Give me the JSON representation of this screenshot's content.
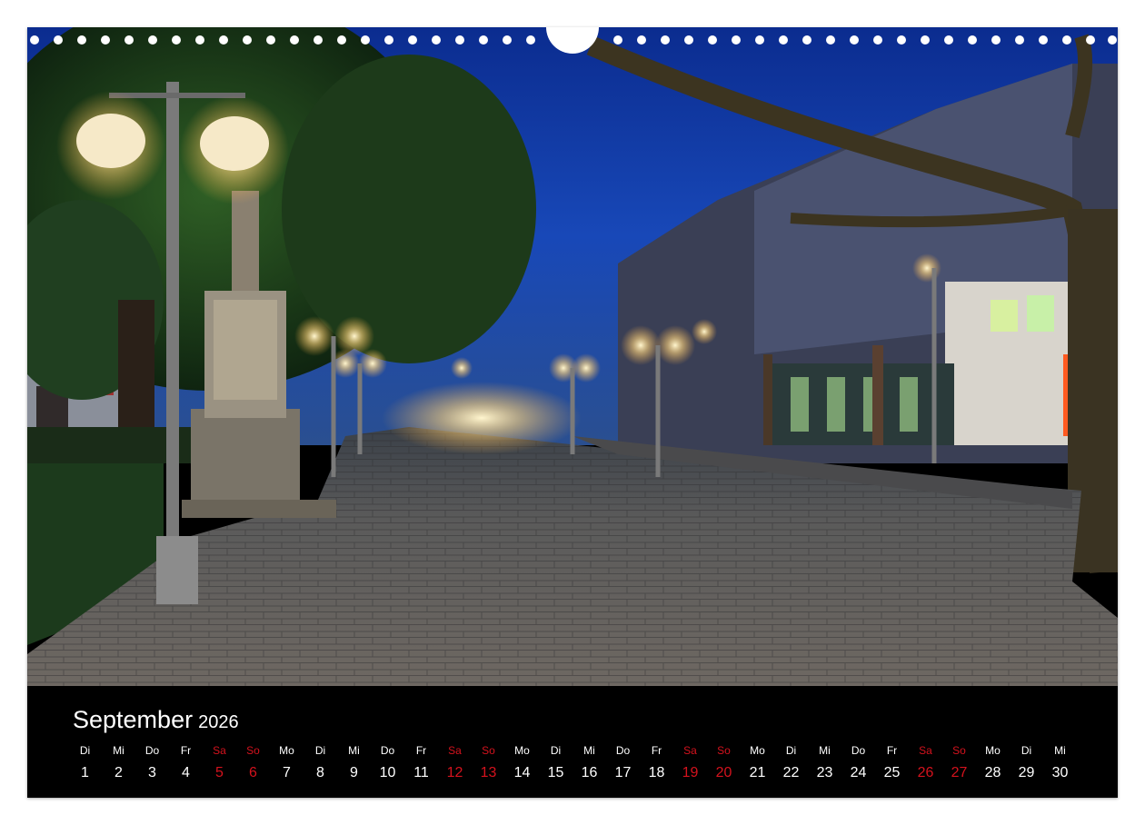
{
  "calendar": {
    "month": "September",
    "year": "2026",
    "weekend_color": "#d4121d",
    "text_color": "#ffffff",
    "days": [
      {
        "dow": "Di",
        "num": "1",
        "weekend": false
      },
      {
        "dow": "Mi",
        "num": "2",
        "weekend": false
      },
      {
        "dow": "Do",
        "num": "3",
        "weekend": false
      },
      {
        "dow": "Fr",
        "num": "4",
        "weekend": false
      },
      {
        "dow": "Sa",
        "num": "5",
        "weekend": true
      },
      {
        "dow": "So",
        "num": "6",
        "weekend": true
      },
      {
        "dow": "Mo",
        "num": "7",
        "weekend": false
      },
      {
        "dow": "Di",
        "num": "8",
        "weekend": false
      },
      {
        "dow": "Mi",
        "num": "9",
        "weekend": false
      },
      {
        "dow": "Do",
        "num": "10",
        "weekend": false
      },
      {
        "dow": "Fr",
        "num": "11",
        "weekend": false
      },
      {
        "dow": "Sa",
        "num": "12",
        "weekend": true
      },
      {
        "dow": "So",
        "num": "13",
        "weekend": true
      },
      {
        "dow": "Mo",
        "num": "14",
        "weekend": false
      },
      {
        "dow": "Di",
        "num": "15",
        "weekend": false
      },
      {
        "dow": "Mi",
        "num": "16",
        "weekend": false
      },
      {
        "dow": "Do",
        "num": "17",
        "weekend": false
      },
      {
        "dow": "Fr",
        "num": "18",
        "weekend": false
      },
      {
        "dow": "Sa",
        "num": "19",
        "weekend": true
      },
      {
        "dow": "So",
        "num": "20",
        "weekend": true
      },
      {
        "dow": "Mo",
        "num": "21",
        "weekend": false
      },
      {
        "dow": "Di",
        "num": "22",
        "weekend": false
      },
      {
        "dow": "Mi",
        "num": "23",
        "weekend": false
      },
      {
        "dow": "Do",
        "num": "24",
        "weekend": false
      },
      {
        "dow": "Fr",
        "num": "25",
        "weekend": false
      },
      {
        "dow": "Sa",
        "num": "26",
        "weekend": true
      },
      {
        "dow": "So",
        "num": "27",
        "weekend": true
      },
      {
        "dow": "Mo",
        "num": "28",
        "weekend": false
      },
      {
        "dow": "Di",
        "num": "29",
        "weekend": false
      },
      {
        "dow": "Mi",
        "num": "30",
        "weekend": false
      }
    ]
  }
}
